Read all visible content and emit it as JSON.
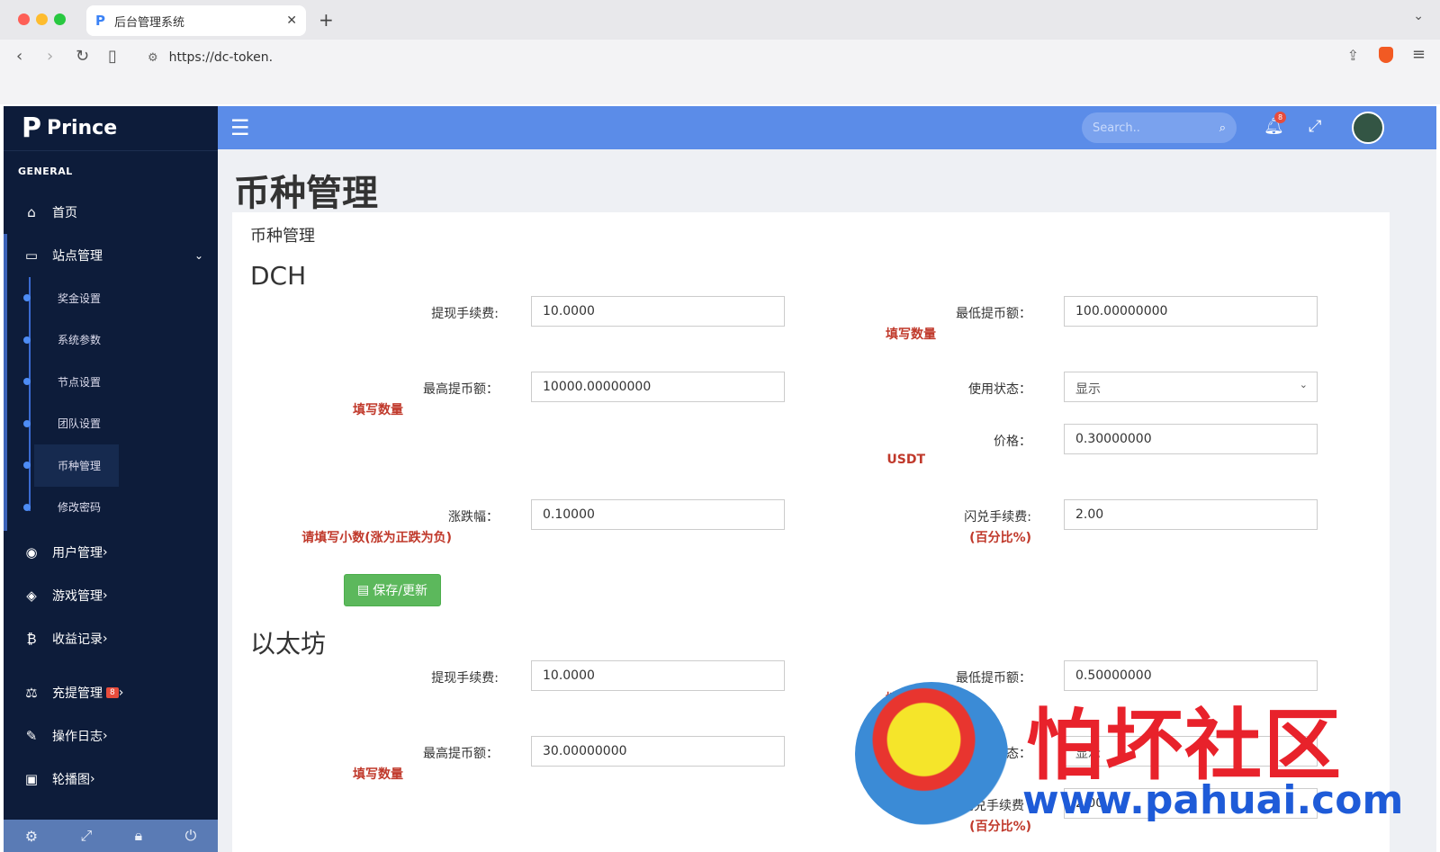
{
  "browser": {
    "tab_title": "后台管理系统",
    "tab_icon": "P",
    "url": "https://dc-token.",
    "colors": {
      "accent": "#5b8ce8",
      "sidebar": "#0d1c3a"
    }
  },
  "sidebar": {
    "brand": "Prince",
    "section": "GENERAL",
    "items": [
      {
        "label": "首页",
        "icon": "home-icon"
      },
      {
        "label": "站点管理",
        "icon": "monitor-icon"
      }
    ],
    "sub_items": [
      "奖金设置",
      "系统参数",
      "节点设置",
      "团队设置",
      "币种管理",
      "修改密码"
    ],
    "more_items": [
      {
        "label": "用户管理",
        "icon": "user-circle-icon"
      },
      {
        "label": "游戏管理",
        "icon": "cube-icon"
      },
      {
        "label": "收益记录",
        "icon": "bitcoin-icon"
      },
      {
        "label": "充提管理",
        "icon": "balance-scale-icon",
        "badge": "8"
      },
      {
        "label": "操作日志",
        "icon": "edit-icon"
      },
      {
        "label": "轮播图",
        "icon": "image-icon"
      }
    ],
    "footer_icons": [
      "gear-icon",
      "expand-icon",
      "lock-icon",
      "power-icon"
    ]
  },
  "topbar": {
    "search_placeholder": "Search..",
    "notification_count": "8"
  },
  "page": {
    "title": "币种管理",
    "card_title": "币种管理",
    "save_button": "保存/更新"
  },
  "coins": [
    {
      "name": "DCH",
      "withdraw_fee_label": "提现手续费:",
      "withdraw_fee": "10.0000",
      "min_withdraw_label": "最低提币额：",
      "min_withdraw": "100.00000000",
      "min_hint": "填写数量",
      "max_withdraw_label": "最高提币额：",
      "max_withdraw": "10000.00000000",
      "max_hint": "填写数量",
      "status_label": "使用状态：",
      "status": "显示",
      "price_label": "价格：",
      "price": "0.30000000",
      "price_hint": "USDT",
      "change_label": "涨跌幅：",
      "change": "0.10000",
      "change_hint": "请填写小数(涨为正跌为负)",
      "swap_fee_label": "闪兑手续费:",
      "swap_fee": "2.00",
      "swap_hint": "(百分比%)"
    },
    {
      "name": "以太坊",
      "withdraw_fee_label": "提现手续费:",
      "withdraw_fee": "10.0000",
      "min_withdraw_label": "最低提币额：",
      "min_withdraw": "0.50000000",
      "min_hint": "填写数量",
      "max_withdraw_label": "最高提币额：",
      "max_withdraw": "30.00000000",
      "max_hint": "填写数量",
      "status_label": "使用状态：",
      "status": "显示",
      "swap_fee_label": "闪兑手续费",
      "swap_fee": "2.00",
      "swap_hint": "(百分比%)"
    }
  ],
  "watermark": {
    "text": "怕坏社区",
    "url": "www.pahuai.com"
  }
}
